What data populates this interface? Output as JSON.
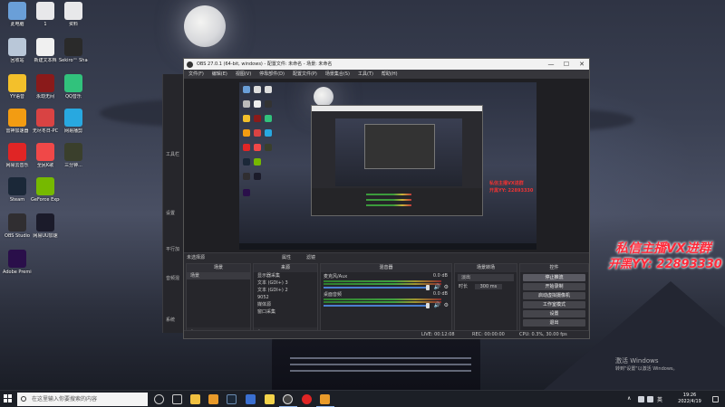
{
  "desktop": {
    "icons": [
      {
        "label": "此电脑",
        "icon": "computer-icon",
        "color": "#6a9fd8"
      },
      {
        "label": "1",
        "icon": "file-icon",
        "color": "#e8e8ea"
      },
      {
        "label": "资料",
        "icon": "file-icon",
        "color": "#e8e8ea"
      },
      {
        "label": "回收站",
        "icon": "recycle-bin-icon",
        "color": "#b9c7d8"
      },
      {
        "label": "新建文本档",
        "icon": "text-file-icon",
        "color": "#f0f0f0"
      },
      {
        "label": "Sekiro™ Shadows...",
        "icon": "sekiro-game-icon",
        "color": "#2a2a2a"
      },
      {
        "label": "YY语音",
        "icon": "yy-icon",
        "color": "#f3c02b"
      },
      {
        "label": "永劫无间",
        "icon": "naraka-game-icon",
        "color": "#8a1a1a"
      },
      {
        "label": "QQ音乐",
        "icon": "qq-music-icon",
        "color": "#31c27c"
      },
      {
        "label": "雷神加速器",
        "icon": "leishen-icon",
        "color": "#f39c12"
      },
      {
        "label": "无尽冬日-PC",
        "icon": "game-icon",
        "color": "#d94343"
      },
      {
        "label": "网易播剪",
        "icon": "video-editor-icon",
        "color": "#28a8e0"
      },
      {
        "label": "网易云音乐",
        "icon": "netease-music-icon",
        "color": "#e02525"
      },
      {
        "label": "全民K歌",
        "icon": "karaoke-icon",
        "color": "#f04848"
      },
      {
        "label": "三分钟...",
        "icon": "game-icon",
        "color": "#3a3f2c"
      },
      {
        "label": "Steam",
        "icon": "steam-icon",
        "color": "#1b2838"
      },
      {
        "label": "GeForce Experience",
        "icon": "geforce-icon",
        "color": "#76b900"
      },
      {
        "label": "OBS Studio",
        "icon": "obs-icon",
        "color": "#302e31"
      },
      {
        "label": "网易UU加速",
        "icon": "uu-accelerator-icon",
        "color": "#1b1b2a"
      },
      {
        "label": "Adobe Premie...",
        "icon": "premiere-icon",
        "color": "#2a0f4a"
      }
    ]
  },
  "background_obs": {
    "items": [
      "工具栏",
      "设置",
      "平行加",
      "音频混",
      "系统"
    ]
  },
  "obs": {
    "title": "OBS 27.0.1 (64-bit, windows) - 配置文件: 未命名 - 场景: 未命名",
    "menu": [
      "文件(F)",
      "编辑(E)",
      "视图(V)",
      "停靠部件(D)",
      "配置文件(P)",
      "场景集合(S)",
      "工具(T)",
      "帮助(H)"
    ],
    "window_controls": {
      "minimize": "—",
      "maximize": "☐",
      "close": "✕"
    },
    "scene_bar": {
      "label": "未选择源",
      "properties": "属性",
      "filters": "滤镜"
    },
    "preview_watermark": [
      "私信主播VX进群",
      "开黑YY: 22893330"
    ],
    "docks": {
      "scenes": {
        "header": "场景",
        "items": [
          "场景"
        ]
      },
      "sources": {
        "header": "来源",
        "items": [
          "显示器采集",
          "文本 (GDI+) 3",
          "文本 (GDI+) 2",
          "9052",
          "媒体源",
          "窗口采集"
        ]
      },
      "mixer": {
        "header": "混音器",
        "channels": [
          {
            "name": "麦克风/Aux",
            "db": "0.0 dB"
          },
          {
            "name": "桌面音频",
            "db": "0.0 dB"
          }
        ]
      },
      "transitions": {
        "header": "场景转场",
        "type": "淡出",
        "duration_label": "时长",
        "duration": "300 ms"
      },
      "controls": {
        "header": "控件",
        "buttons": [
          "停止推流",
          "开始录制",
          "启动虚拟摄像机",
          "工作室模式",
          "设置",
          "退出"
        ]
      },
      "footer_buttons": "+ - ∧ ∨"
    },
    "status": {
      "live": "LIVE: 00:12:08",
      "rec": "REC: 00:00:00",
      "cpu": "CPU: 0.3%, 30.00 fps"
    }
  },
  "overlay": {
    "line1": "私信主播VX进群",
    "line2": "开黑YY: 22893330"
  },
  "activation": {
    "line1": "激活 Windows",
    "line2": "转到\"设置\"以激活 Windows。"
  },
  "taskbar": {
    "search_placeholder": "在这里输入你要搜索的内容",
    "time": "19:26",
    "date": "2022/4/19",
    "ime": "英"
  }
}
